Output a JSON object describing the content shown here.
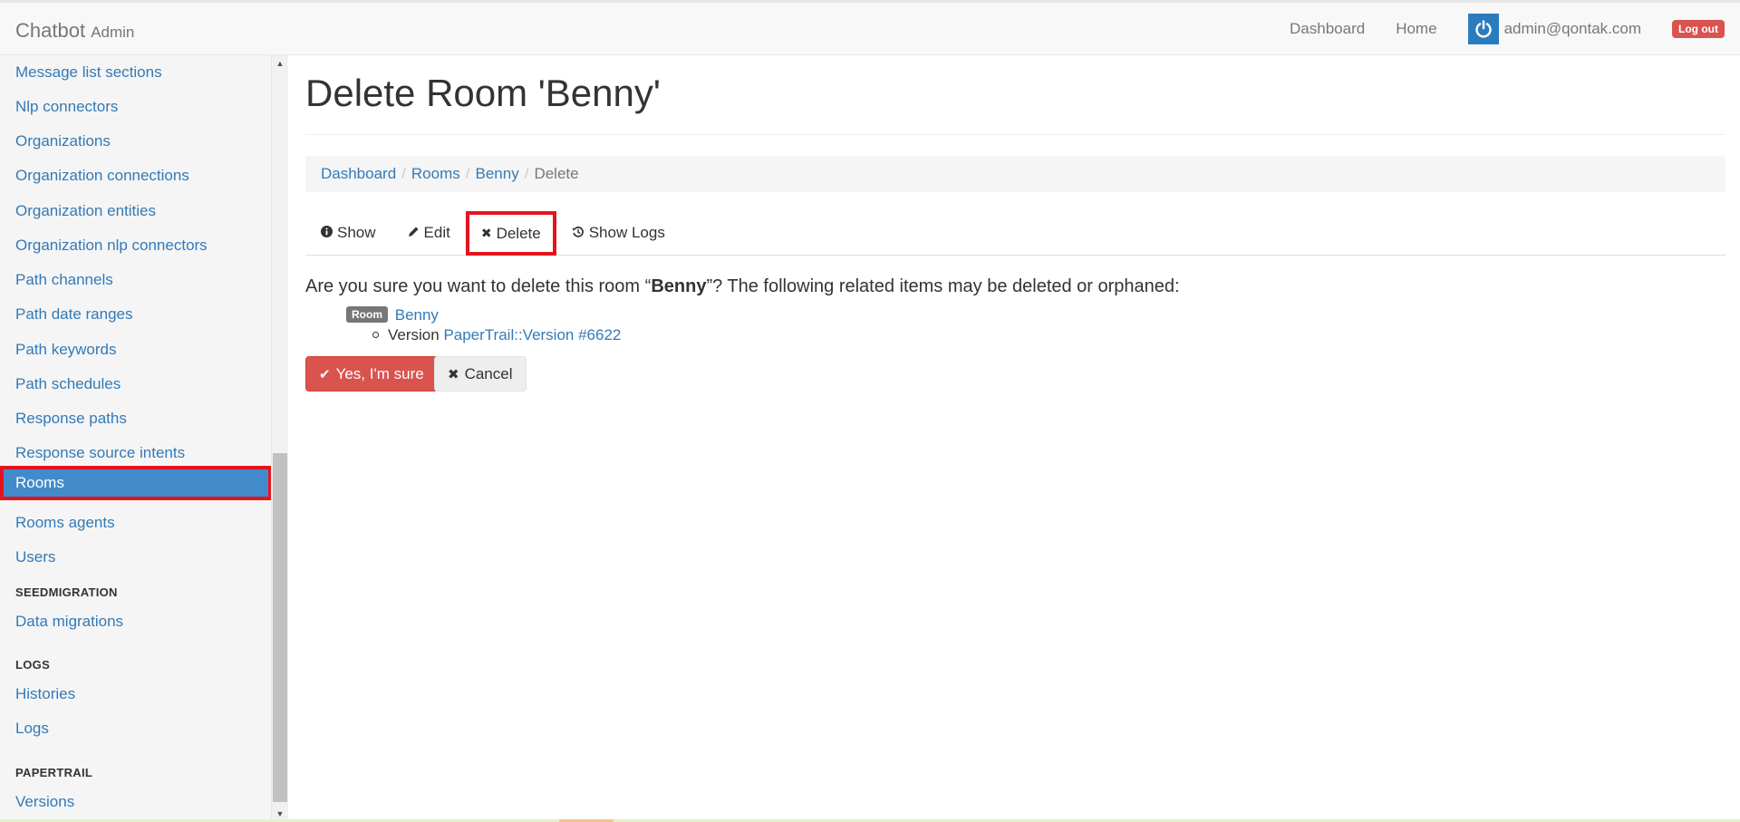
{
  "navbar": {
    "brand": "Chatbot",
    "brand_sub": "Admin",
    "links": [
      "Dashboard",
      "Home"
    ],
    "user_email": "admin@qontak.com",
    "logout_label": "Log out",
    "avatar_icon": "power-icon",
    "accent_color": "#2b7bbf"
  },
  "sidebar": {
    "items": [
      "Message list sections",
      "Nlp connectors",
      "Organizations",
      "Organization connections",
      "Organization entities",
      "Organization nlp connectors",
      "Path channels",
      "Path date ranges",
      "Path keywords",
      "Path schedules",
      "Response paths",
      "Response source intents",
      "Rooms",
      "Rooms agents",
      "Users"
    ],
    "active_item": "Rooms",
    "sections": [
      {
        "header": "SEEDMIGRATION",
        "items": [
          "Data migrations"
        ]
      },
      {
        "header": "LOGS",
        "items": [
          "Histories",
          "Logs"
        ]
      },
      {
        "header": "PAPERTRAIL",
        "items": [
          "Versions"
        ]
      }
    ]
  },
  "main": {
    "title": "Delete Room 'Benny'",
    "breadcrumb": [
      "Dashboard",
      "Rooms",
      "Benny",
      "Delete"
    ],
    "tabs": [
      {
        "label": "Show",
        "icon": "info-circle-icon"
      },
      {
        "label": "Edit",
        "icon": "pencil-icon"
      },
      {
        "label": "Delete",
        "icon": "times-icon",
        "active": true
      },
      {
        "label": "Show Logs",
        "icon": "history-icon"
      }
    ],
    "confirm_prefix": "Are you sure you want to delete this room “",
    "confirm_name": "Benny",
    "confirm_suffix": "”? The following related items may be deleted or orphaned:",
    "related_badge": "Room",
    "related_link": "Benny",
    "sub_item_prefix": "Version",
    "sub_item_link": "PaperTrail::Version #6622",
    "confirm_button": "Yes, I'm sure",
    "cancel_button": "Cancel"
  }
}
